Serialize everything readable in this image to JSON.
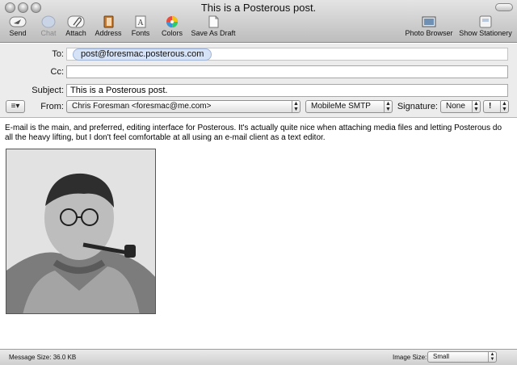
{
  "window": {
    "title": "This is a Posterous post."
  },
  "toolbar": {
    "send": "Send",
    "chat": "Chat",
    "attach": "Attach",
    "address": "Address",
    "fonts": "Fonts",
    "colors": "Colors",
    "save_as_draft": "Save As Draft",
    "photo_browser": "Photo Browser",
    "show_stationery": "Show Stationery"
  },
  "header": {
    "to_label": "To:",
    "to_recipient": "post@foresmac.posterous.com",
    "cc_label": "Cc:",
    "cc_value": "",
    "subject_label": "Subject:",
    "subject_value": "This is a Posterous post.",
    "from_label": "From:",
    "from_value": "Chris Foresman <foresmac@me.com>",
    "smtp_value": "MobileMe SMTP",
    "signature_label": "Signature:",
    "signature_value": "None",
    "priority_value": "!"
  },
  "body": {
    "text": "E-mail is the main, and preferred, editing interface for Posterous. It's actually quite nice when attaching media files and letting Posterous do all the heavy lifting, but I don't feel comfortable at all using an e-mail client as a text editor."
  },
  "status": {
    "message_size_label": "Message Size: 36.0 KB",
    "image_size_label": "Image Size:",
    "image_size_value": "Small"
  }
}
